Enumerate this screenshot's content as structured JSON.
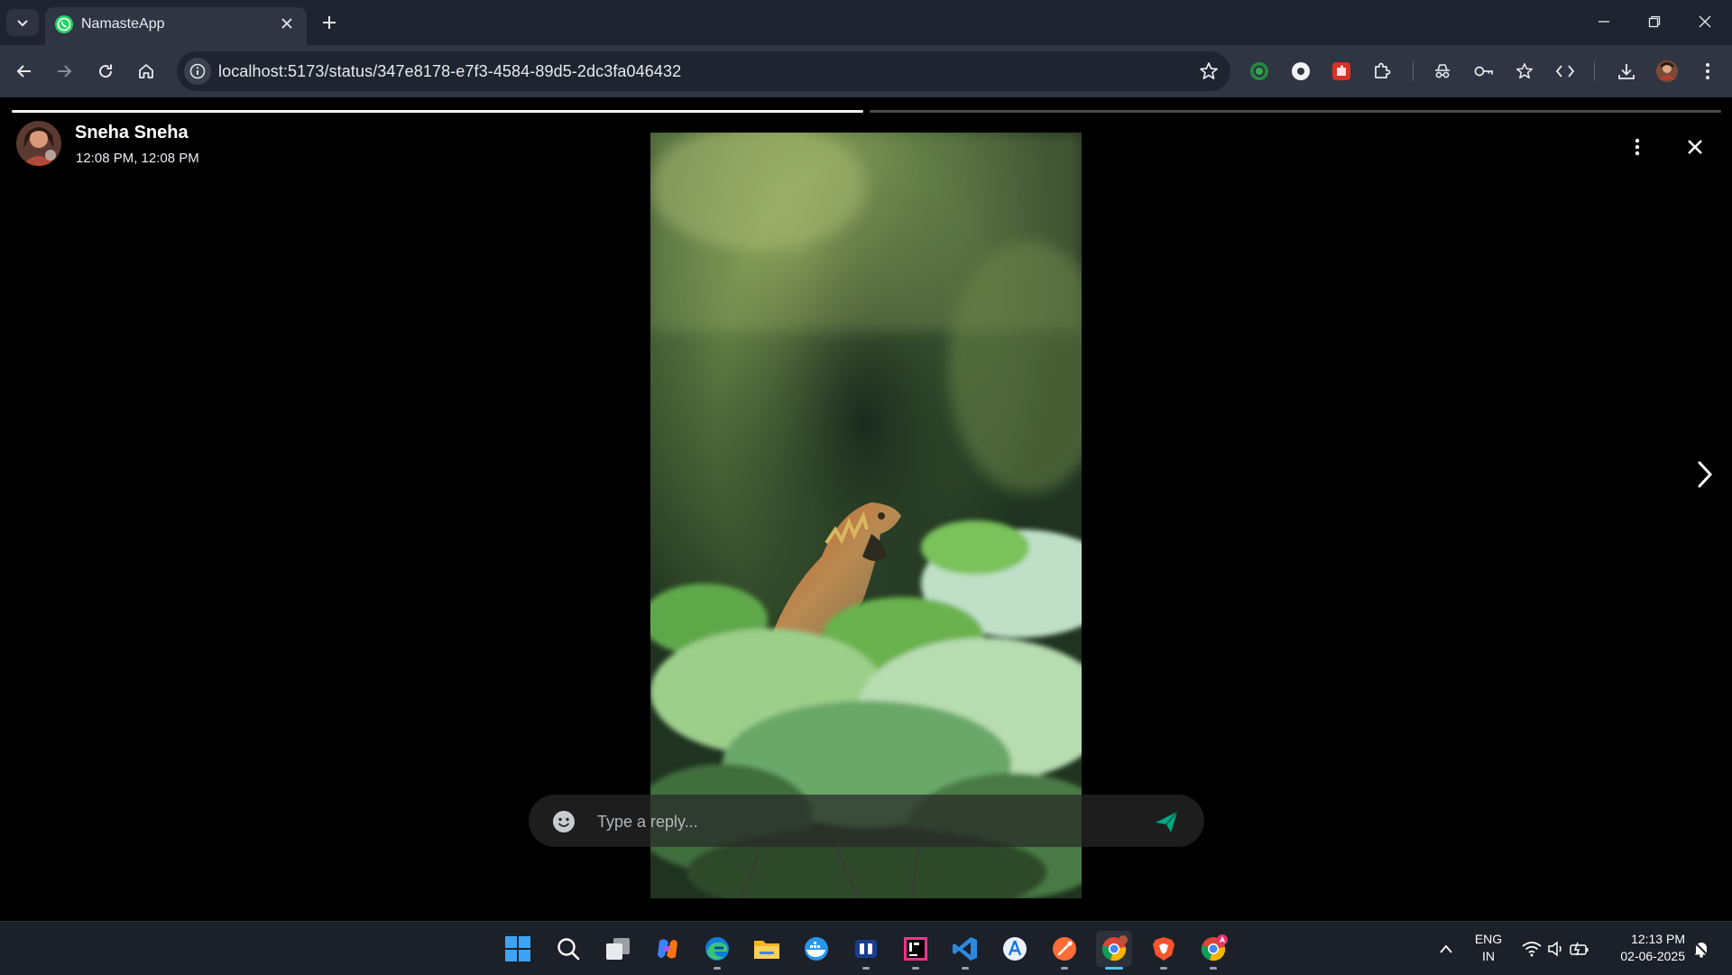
{
  "browser": {
    "tab": {
      "title": "NamasteApp",
      "favicon": "whatsapp-icon"
    },
    "url": "localhost:5173/status/347e8178-e7f3-4584-89d5-2dc3fa046432",
    "icons": {
      "back": "arrow-left-icon",
      "forward": "arrow-right-icon",
      "reload": "reload-icon",
      "home": "home-icon",
      "bookmark": "star-icon"
    },
    "extensions": [
      "ring-extension-icon",
      "white-circle-extension-icon",
      "red-puzzle-extension-icon",
      "extensions-puzzle-icon",
      "incognito-icon",
      "password-key-icon",
      "favorites-star-icon",
      "code-icon",
      "download-icon",
      "profile-avatar",
      "menu-kebab-icon"
    ]
  },
  "status": {
    "user_name": "Sneha Sneha",
    "time": "12:08 PM, 12:08 PM",
    "progress_segments": [
      1,
      0
    ],
    "reply_placeholder": "Type a reply...",
    "icons": {
      "more": "more-vertical-icon",
      "close": "close-icon",
      "next": "chevron-right-icon",
      "emoji": "emoji-icon",
      "send": "send-icon"
    },
    "colors": {
      "send": "#00a884",
      "progress_done": "#f1f1f1",
      "progress_todo": "#4a4a4a"
    }
  },
  "taskbar": {
    "apps": [
      "windows-start-icon",
      "search-icon",
      "task-view-icon",
      "copilot-icon",
      "edge-icon",
      "file-explorer-icon",
      "docker-icon",
      "teams-icon",
      "intellij-icon",
      "vscode-icon",
      "app-store-icon",
      "postman-icon",
      "chrome-icon",
      "brave-icon",
      "chrome-profile-icon"
    ],
    "lang_line1": "ENG",
    "lang_line2": "IN",
    "time": "12:13 PM",
    "date": "02-06-2025"
  }
}
